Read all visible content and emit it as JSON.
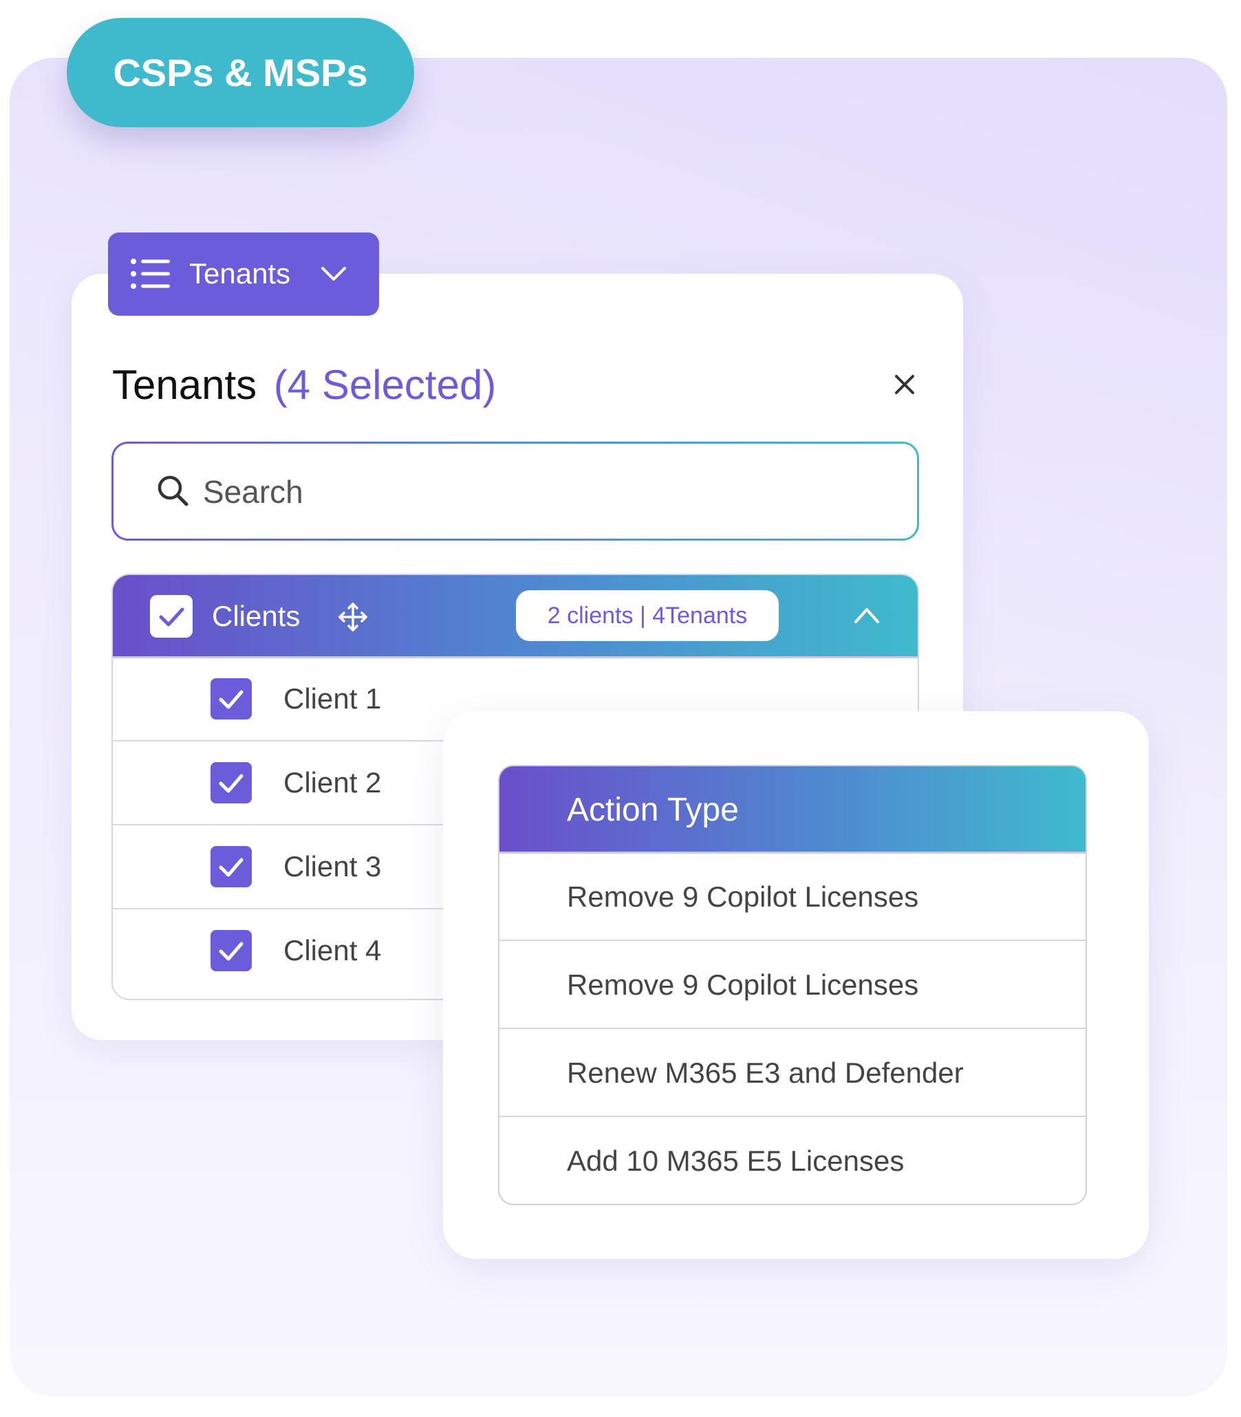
{
  "badge": {
    "label": "CSPs & MSPs"
  },
  "tenants_tab": {
    "label": "Tenants",
    "list_icon": "list-icon",
    "chevron_icon": "chevron-down-icon"
  },
  "panel": {
    "title": "Tenants",
    "selected_text": "(4 Selected)",
    "close_icon": "close-icon"
  },
  "search": {
    "placeholder": "Search",
    "value": "",
    "icon": "search-icon"
  },
  "clients_group": {
    "label": "Clients",
    "checked": true,
    "move_icon": "move-icon",
    "summary": "2 clients | 4Tenants",
    "collapse_icon": "chevron-up-icon",
    "items": [
      {
        "label": "Client 1",
        "checked": true
      },
      {
        "label": "Client 2",
        "checked": true
      },
      {
        "label": "Client 3",
        "checked": true
      },
      {
        "label": "Client 4",
        "checked": true
      }
    ]
  },
  "action_table": {
    "header": "Action Type",
    "rows": [
      {
        "label": "Remove 9 Copilot Licenses"
      },
      {
        "label": "Remove 9 Copilot Licenses"
      },
      {
        "label": "Renew M365 E3 and Defender"
      },
      {
        "label": "Add 10 M365 E5 Licenses"
      }
    ]
  },
  "colors": {
    "brand_purple": "#6b5cdb",
    "brand_teal": "#3fbacd",
    "background_lavender": "#ece8fd"
  }
}
